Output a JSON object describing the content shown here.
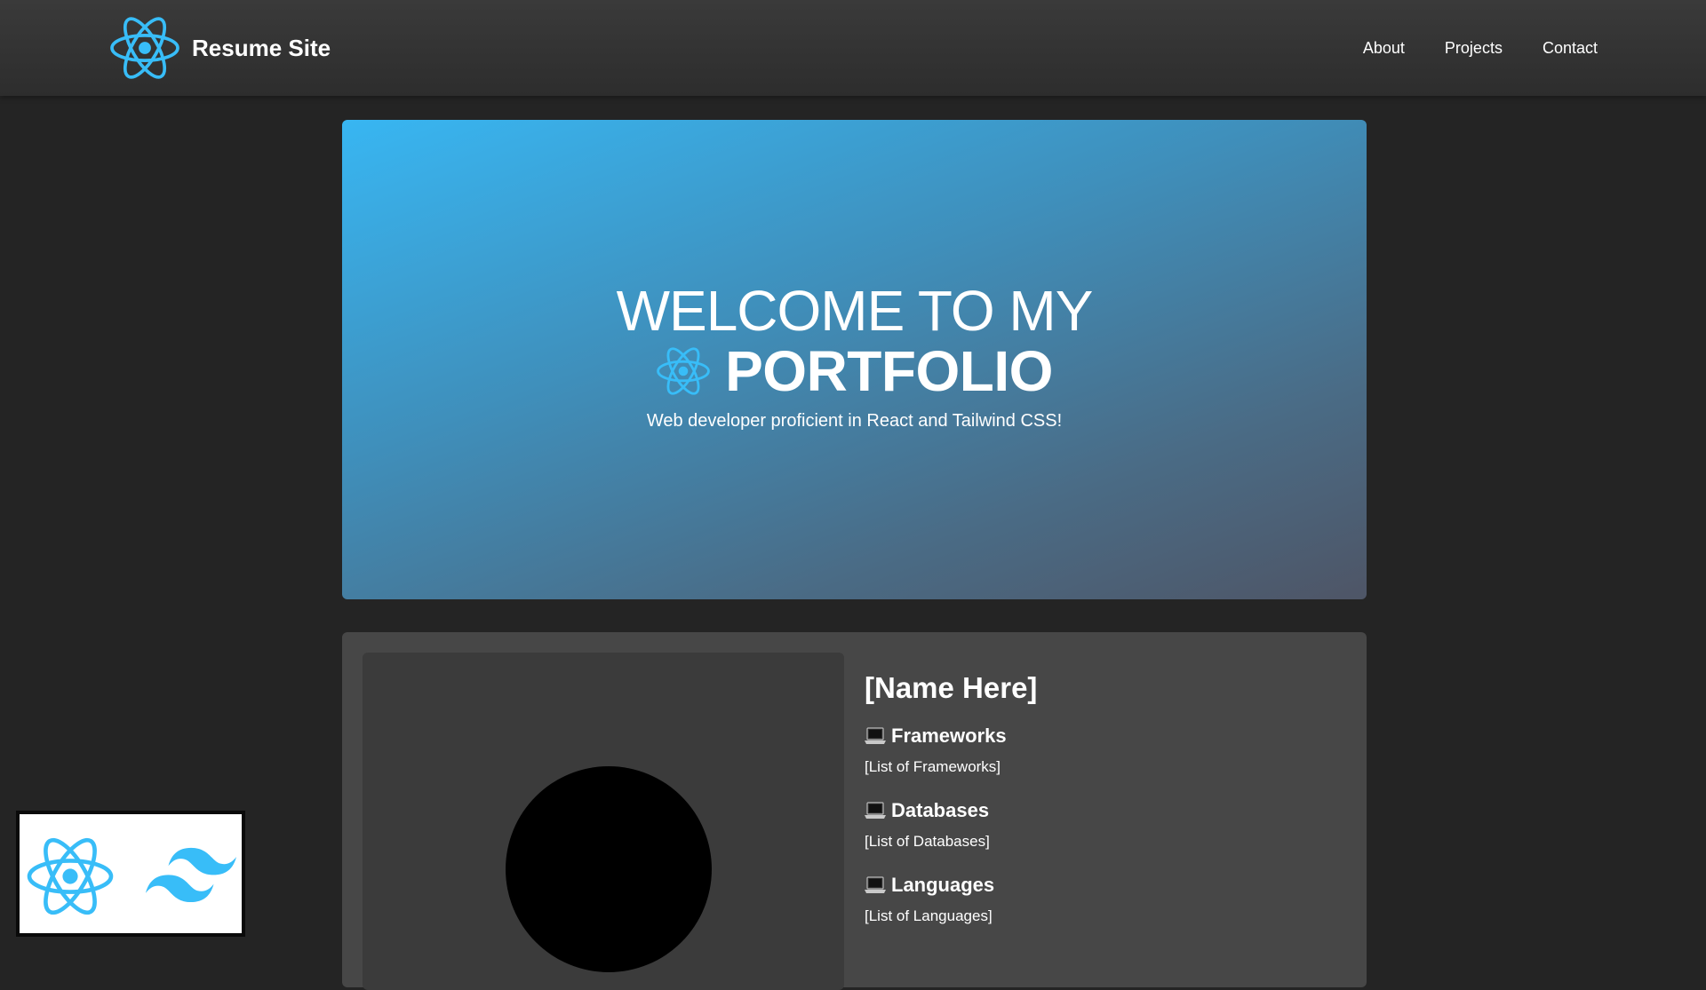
{
  "nav": {
    "brand_icon": "react-atom-icon",
    "brand_title": "Resume Site",
    "links": [
      "About",
      "Projects",
      "Contact"
    ]
  },
  "hero": {
    "line1": "WELCOME TO MY",
    "icon": "react-atom-icon",
    "line2": "PORTFOLIO",
    "subtitle": "Web developer proficient in React and Tailwind CSS!"
  },
  "profile": {
    "name": "[Name Here]",
    "sections": [
      {
        "icon": "laptop-icon",
        "title": "Frameworks",
        "body": "[List of Frameworks]"
      },
      {
        "icon": "laptop-icon",
        "title": "Databases",
        "body": "[List of Databases]"
      },
      {
        "icon": "laptop-icon",
        "title": "Languages",
        "body": "[List of Languages]"
      }
    ]
  },
  "badge": {
    "icons": [
      "react-atom-icon",
      "tailwind-icon"
    ]
  },
  "colors": {
    "accent": "#38bdf8",
    "background": "#242424",
    "card": "#474747",
    "hero_gradient_start": "#38b6f2",
    "hero_gradient_end": "#4e5566"
  }
}
